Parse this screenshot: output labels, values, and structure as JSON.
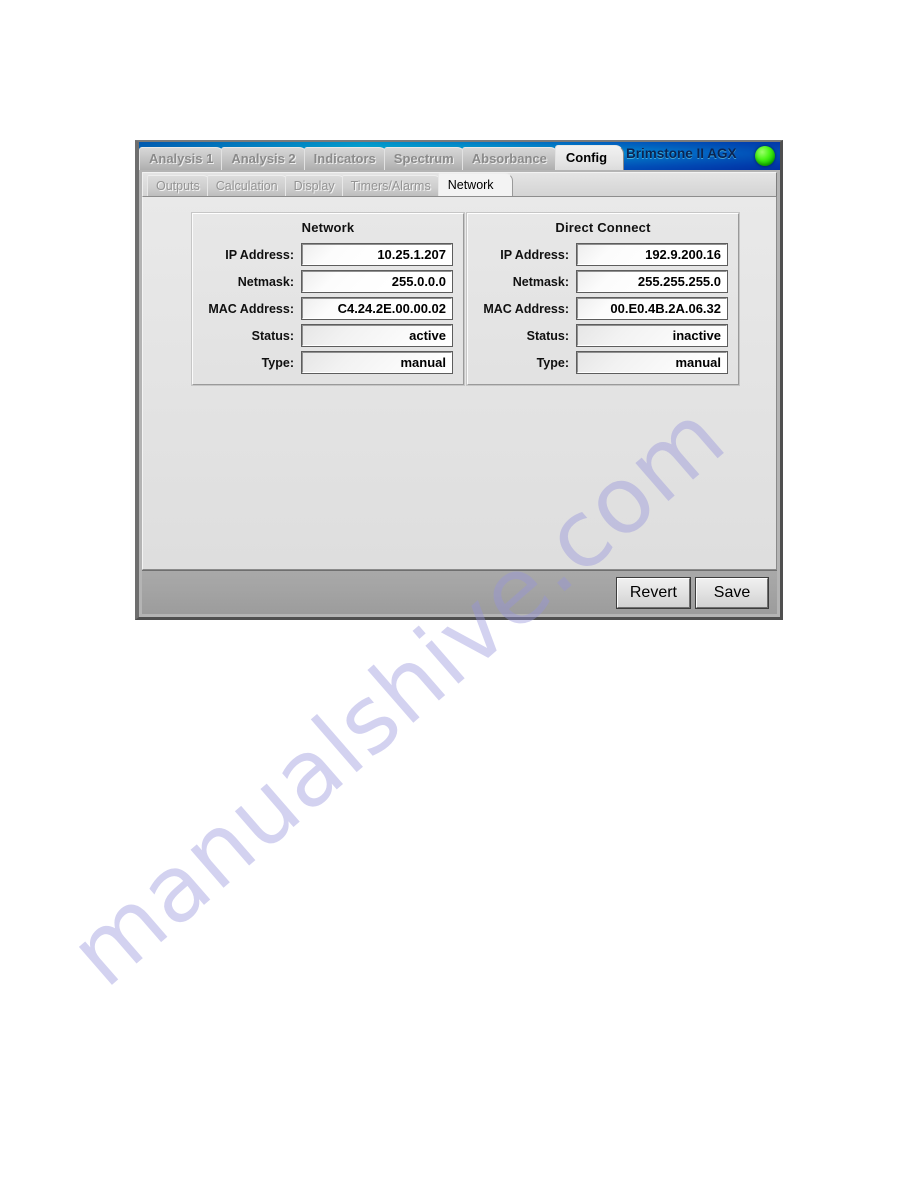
{
  "window": {
    "title": "Brimstone II AGX",
    "status_led": "green-led-icon"
  },
  "top_tabs": [
    {
      "label": "Analysis 1",
      "active": false
    },
    {
      "label": "Analysis 2",
      "active": false
    },
    {
      "label": "Indicators",
      "active": false
    },
    {
      "label": "Spectrum",
      "active": false
    },
    {
      "label": "Absorbance",
      "active": false
    },
    {
      "label": "Config",
      "active": true
    }
  ],
  "sub_tabs": [
    {
      "label": "Outputs",
      "active": false
    },
    {
      "label": "Calculation",
      "active": false
    },
    {
      "label": "Display",
      "active": false
    },
    {
      "label": "Timers/Alarms",
      "active": false
    },
    {
      "label": "Network",
      "active": true
    }
  ],
  "panels": [
    {
      "title": "Network",
      "fields": [
        {
          "label": "IP Address:",
          "value": "10.25.1.207",
          "readonly": false
        },
        {
          "label": "Netmask:",
          "value": "255.0.0.0",
          "readonly": false
        },
        {
          "label": "MAC Address:",
          "value": "C4.24.2E.00.00.02",
          "readonly": false
        },
        {
          "label": "Status:",
          "value": "active",
          "readonly": true
        },
        {
          "label": "Type:",
          "value": "manual",
          "readonly": true
        }
      ]
    },
    {
      "title": "Direct Connect",
      "fields": [
        {
          "label": "IP Address:",
          "value": "192.9.200.16",
          "readonly": false
        },
        {
          "label": "Netmask:",
          "value": "255.255.255.0",
          "readonly": false
        },
        {
          "label": "MAC Address:",
          "value": "00.E0.4B.2A.06.32",
          "readonly": false
        },
        {
          "label": "Status:",
          "value": "inactive",
          "readonly": true
        },
        {
          "label": "Type:",
          "value": "manual",
          "readonly": true
        }
      ]
    }
  ],
  "buttons": [
    {
      "label": "Revert"
    },
    {
      "label": "Save"
    }
  ],
  "watermark": {
    "text": "manualshive.com"
  },
  "colors": {
    "titlebar_teal": "#13a2b4",
    "titlebar_blue": "#093f86",
    "led_green": "#4bf517",
    "window_face": "#b4b4b4",
    "content_face": "#e4e4e4",
    "buttonbar_face": "#a3a3a3",
    "watermark_purple": "#9694dc"
  }
}
